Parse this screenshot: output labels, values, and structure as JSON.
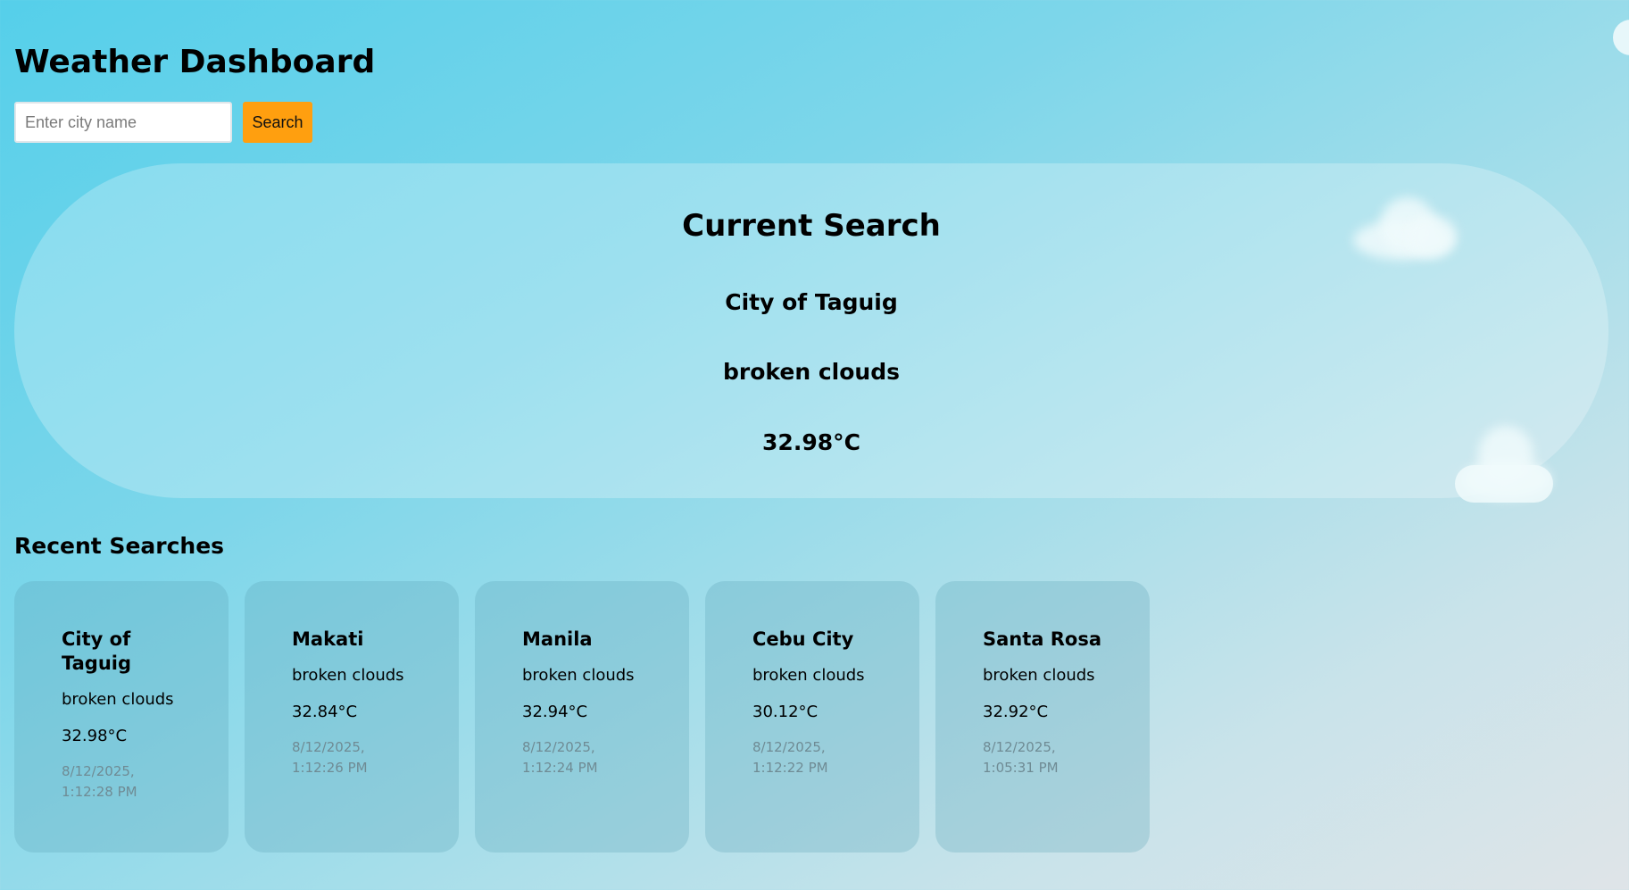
{
  "header": {
    "title": "Weather Dashboard"
  },
  "search": {
    "placeholder": "Enter city name",
    "value": "",
    "button_label": "Search"
  },
  "current": {
    "heading": "Current Search",
    "city": "City of Taguig",
    "description": "broken clouds",
    "temperature": "32.98°C"
  },
  "recent": {
    "heading": "Recent Searches",
    "items": [
      {
        "city": "City of Taguig",
        "description": "broken clouds",
        "temperature": "32.98°C",
        "timestamp": "8/12/2025, 1:12:28 PM"
      },
      {
        "city": "Makati",
        "description": "broken clouds",
        "temperature": "32.84°C",
        "timestamp": "8/12/2025, 1:12:26 PM"
      },
      {
        "city": "Manila",
        "description": "broken clouds",
        "temperature": "32.94°C",
        "timestamp": "8/12/2025, 1:12:24 PM"
      },
      {
        "city": "Cebu City",
        "description": "broken clouds",
        "temperature": "30.12°C",
        "timestamp": "8/12/2025, 1:12:22 PM"
      },
      {
        "city": "Santa Rosa",
        "description": "broken clouds",
        "temperature": "32.92°C",
        "timestamp": "8/12/2025, 1:05:31 PM"
      }
    ]
  },
  "colors": {
    "accent": "#ff9f0f",
    "background_start": "#55cfea",
    "background_end": "#dfe4e8"
  },
  "icons": [
    "cloud-decoration-icon"
  ]
}
